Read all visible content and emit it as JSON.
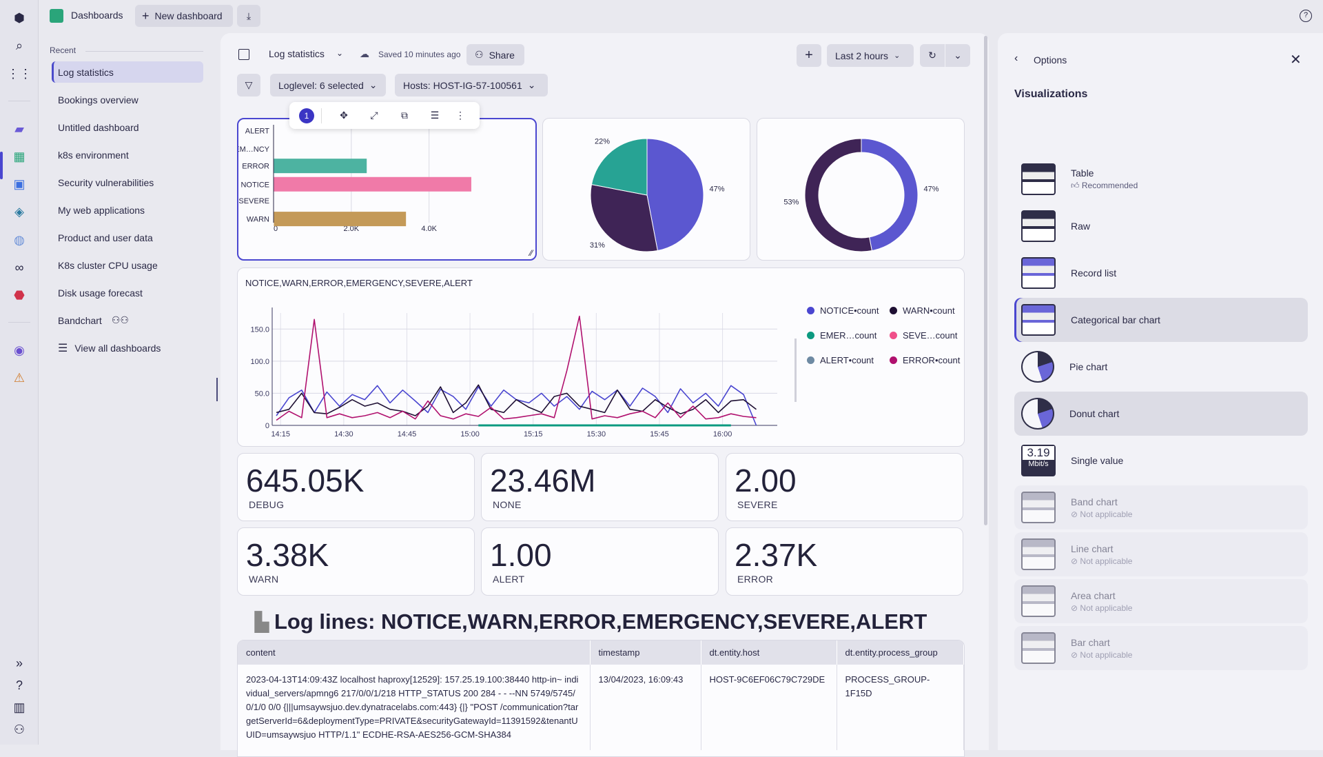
{
  "topbar": {
    "app_title": "Dashboards",
    "new_dashboard": "New dashboard",
    "download_icon": "download-icon",
    "help_icon": "help-icon"
  },
  "sidebar": {
    "section": "Recent",
    "items": [
      {
        "label": "Log statistics",
        "active": true
      },
      {
        "label": "Bookings overview"
      },
      {
        "label": "Untitled dashboard"
      },
      {
        "label": "k8s environment"
      },
      {
        "label": "Security vulnerabilities"
      },
      {
        "label": "My web applications"
      },
      {
        "label": "Product and user data"
      },
      {
        "label": "K8s cluster CPU usage"
      },
      {
        "label": "Disk usage forecast"
      },
      {
        "label": "Bandchart",
        "shared": true
      }
    ],
    "view_all": "View all dashboards"
  },
  "toolbar": {
    "title": "Log statistics",
    "saved": "Saved 10 minutes ago",
    "share": "Share",
    "timeframe": "Last 2 hours"
  },
  "filters": {
    "loglevel": "Loglevel: 6 selected",
    "hosts": "Hosts: HOST-IG-57-100561"
  },
  "tile_toolbar": {
    "badge": "1"
  },
  "chart_data": [
    {
      "type": "bar",
      "orientation": "horizontal",
      "categories": [
        "ALERT",
        "EM…NCY",
        "ERROR",
        "NOTICE",
        "SEVERE",
        "WARN"
      ],
      "values": [
        0,
        0,
        2370,
        5060,
        0,
        3380
      ],
      "colors": [
        "#9a9ab0",
        "#9a9ab0",
        "#4db3a1",
        "#f07aa8",
        "#9a9ab0",
        "#c49a58"
      ],
      "xlim": [
        0,
        5300
      ],
      "xticks": [
        "0",
        "2.0K",
        "4.0K"
      ],
      "xtick_values": [
        0,
        2000,
        4000
      ]
    },
    {
      "type": "pie",
      "slices": [
        {
          "label": "47%",
          "value": 47,
          "color": "#5b57d0"
        },
        {
          "label": "31%",
          "value": 31,
          "color": "#3f2456"
        },
        {
          "label": "22%",
          "value": 22,
          "color": "#27a394"
        }
      ]
    },
    {
      "type": "pie",
      "donut": true,
      "slices": [
        {
          "label": "47%",
          "value": 47,
          "color": "#5b57d0"
        },
        {
          "label": "53%",
          "value": 53,
          "color": "#3f2456"
        }
      ]
    },
    {
      "type": "line",
      "title": "NOTICE,WARN,ERROR,EMERGENCY,SEVERE,ALERT",
      "ylim": [
        0,
        175
      ],
      "yticks": [
        "0",
        "50.0",
        "100.0",
        "150.0"
      ],
      "ytick_values": [
        0,
        50,
        100,
        150
      ],
      "xlim": [
        "14:13",
        "16:13"
      ],
      "xticks": [
        "14:15",
        "14:30",
        "14:45",
        "15:00",
        "15:15",
        "15:30",
        "15:45",
        "16:00"
      ],
      "grid": true,
      "legend": "right",
      "x": [
        "14:14",
        "14:17",
        "14:20",
        "14:23",
        "14:26",
        "14:29",
        "14:32",
        "14:35",
        "14:38",
        "14:41",
        "14:44",
        "14:47",
        "14:50",
        "14:53",
        "14:56",
        "14:59",
        "15:02",
        "15:05",
        "15:08",
        "15:11",
        "15:14",
        "15:17",
        "15:20",
        "15:23",
        "15:26",
        "15:29",
        "15:32",
        "15:35",
        "15:38",
        "15:41",
        "15:44",
        "15:47",
        "15:50",
        "15:53",
        "15:56",
        "15:59",
        "16:02",
        "16:05",
        "16:08"
      ],
      "series": [
        {
          "name": "NOTICE•count",
          "color": "#4a46d0",
          "values": [
            15,
            43,
            55,
            20,
            52,
            30,
            48,
            40,
            62,
            35,
            55,
            38,
            20,
            56,
            45,
            25,
            60,
            30,
            55,
            40,
            35,
            50,
            30,
            45,
            25,
            53,
            40,
            55,
            30,
            58,
            45,
            20,
            57,
            35,
            50,
            30,
            62,
            48,
            0
          ]
        },
        {
          "name": "WARN•count",
          "color": "#1e0f33",
          "values": [
            20,
            25,
            50,
            20,
            18,
            28,
            40,
            30,
            35,
            25,
            22,
            15,
            30,
            60,
            20,
            35,
            63,
            25,
            20,
            40,
            28,
            20,
            45,
            50,
            30,
            25,
            20,
            55,
            25,
            22,
            40,
            28,
            18,
            25,
            40,
            20,
            38,
            40,
            25
          ]
        },
        {
          "name": "EMER…count",
          "color": "#0c9a80",
          "values": [
            null,
            null,
            null,
            null,
            null,
            null,
            null,
            null,
            null,
            null,
            null,
            null,
            null,
            null,
            null,
            null,
            0,
            0,
            0,
            0,
            0,
            0,
            0,
            0,
            0,
            0,
            0,
            0,
            0,
            0,
            0,
            0,
            0,
            0,
            0,
            0,
            0,
            null,
            null
          ]
        },
        {
          "name": "SEVE…count",
          "color": "#f0508a",
          "values": []
        },
        {
          "name": "ALERT•count",
          "color": "#6e8aa3",
          "values": []
        },
        {
          "name": "ERROR•count",
          "color": "#b0106e",
          "values": [
            8,
            22,
            12,
            165,
            12,
            18,
            12,
            15,
            20,
            12,
            22,
            10,
            38,
            15,
            10,
            18,
            14,
            28,
            10,
            12,
            15,
            18,
            12,
            85,
            170,
            10,
            15,
            12,
            18,
            22,
            12,
            35,
            12,
            30,
            10,
            12,
            18,
            14,
            12
          ]
        }
      ]
    }
  ],
  "single_values": [
    {
      "value": "645.05K",
      "label": "DEBUG"
    },
    {
      "value": "23.46M",
      "label": "NONE"
    },
    {
      "value": "2.00",
      "label": "SEVERE"
    },
    {
      "value": "3.38K",
      "label": "WARN"
    },
    {
      "value": "1.00",
      "label": "ALERT"
    },
    {
      "value": "2.37K",
      "label": "ERROR"
    }
  ],
  "log_table": {
    "heading": "Log lines: NOTICE,WARN,ERROR,EMERGENCY,SEVERE,ALERT",
    "columns": [
      "content",
      "timestamp",
      "dt.entity.host",
      "dt.entity.process_group"
    ],
    "rows": [
      {
        "content": "2023-04-13T14:09:43Z localhost haproxy[12529]: 157.25.19.100:38440 http-in~ individual_servers/apmng6 217/0/0/1/218 HTTP_STATUS 200 284 - - --NN 5749/5745/0/1/0 0/0 {|||umsaywsjuo.dev.dynatracelabs.com:443} {|} \"POST /communication?targetServerId=6&deploymentType=PRIVATE&securityGatewayId=11391592&tenantUUID=umsaywsjuo HTTP/1.1\" ECDHE-RSA-AES256-GCM-SHA384",
        "timestamp": "13/04/2023, 16:09:43",
        "host": "HOST-9C6EF06C79C729DE",
        "process_group": "PROCESS_GROUP-1F15D"
      }
    ]
  },
  "options": {
    "back": "Options",
    "title": "Visualizations",
    "items": [
      {
        "label": "Table",
        "sub": "Recommended",
        "state": "normal"
      },
      {
        "label": "Raw",
        "state": "normal"
      },
      {
        "label": "Record list",
        "state": "normal"
      },
      {
        "label": "Categorical bar chart",
        "state": "selected"
      },
      {
        "label": "Pie chart",
        "state": "normal"
      },
      {
        "label": "Donut chart",
        "state": "hover"
      },
      {
        "label": "Single value",
        "state": "normal",
        "icon_value": "3.19",
        "icon_unit": "Mbit/s"
      },
      {
        "label": "Band chart",
        "sub": "Not applicable",
        "state": "disabled"
      },
      {
        "label": "Line chart",
        "sub": "Not applicable",
        "state": "disabled"
      },
      {
        "label": "Area chart",
        "sub": "Not applicable",
        "state": "disabled"
      },
      {
        "label": "Bar chart",
        "sub": "Not applicable",
        "state": "disabled"
      }
    ]
  }
}
